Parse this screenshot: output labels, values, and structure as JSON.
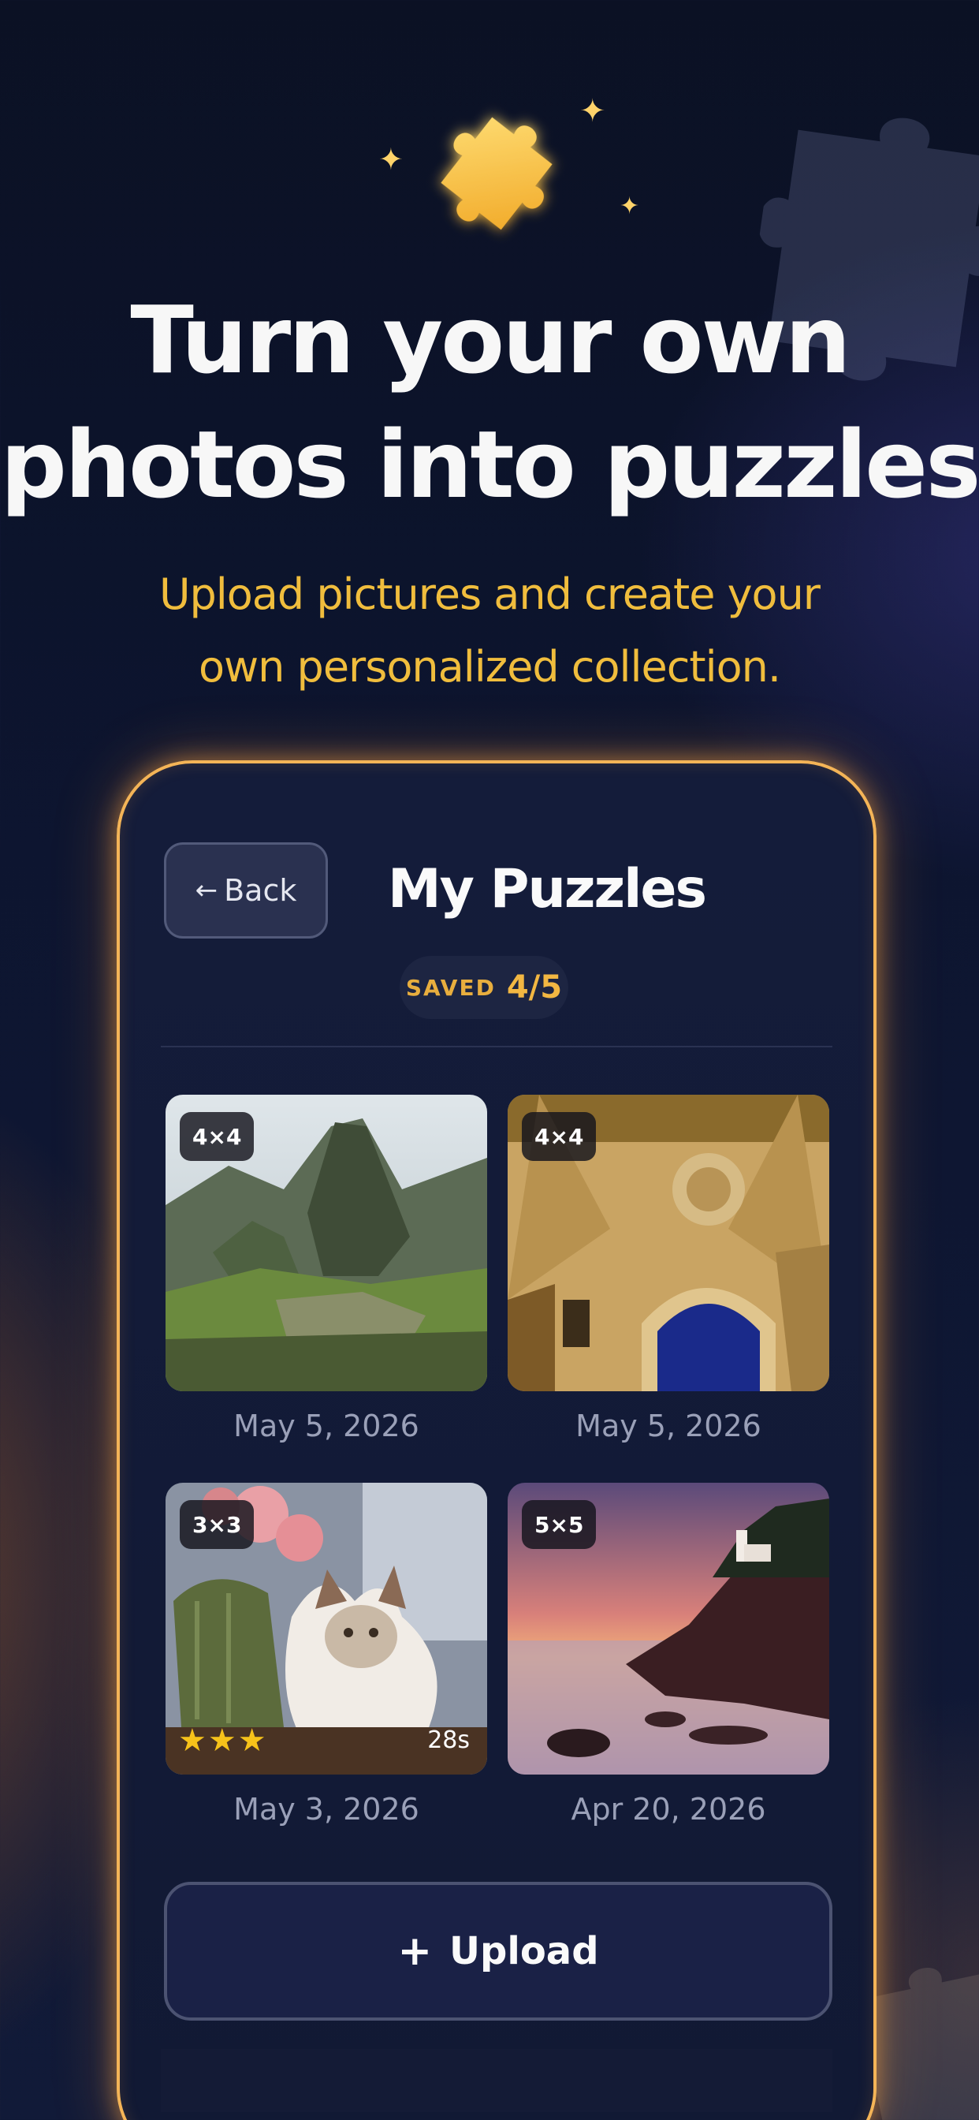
{
  "hero": {
    "headline": "Turn your own\nphotos into puzzles",
    "subheadline": "Upload pictures and create your\nown personalized collection."
  },
  "screen": {
    "back_label": "Back",
    "title": "My Puzzles",
    "saved_label": "SAVED",
    "saved_count": "4/5",
    "puzzles": [
      {
        "grid": "4×4",
        "date": "May 5, 2026",
        "image": "mountain-ruins-photo"
      },
      {
        "grid": "4×4",
        "date": "May 5, 2026",
        "image": "ornate-archway-photo"
      },
      {
        "grid": "3×3",
        "date": "May 3, 2026",
        "image": "cat-with-flowers-photo",
        "stars": "★★★",
        "time": "28s"
      },
      {
        "grid": "5×5",
        "date": "Apr 20, 2026",
        "image": "sunset-lighthouse-coast-photo"
      }
    ],
    "upload_label": "Upload"
  },
  "colors": {
    "accent": "#f0bd3d",
    "glow_border": "#f4b457",
    "background": "#0d1530"
  },
  "icons": {
    "hero": "puzzle-piece-icon",
    "back": "arrow-left-icon",
    "upload": "plus-icon",
    "rating": "star-icon"
  }
}
